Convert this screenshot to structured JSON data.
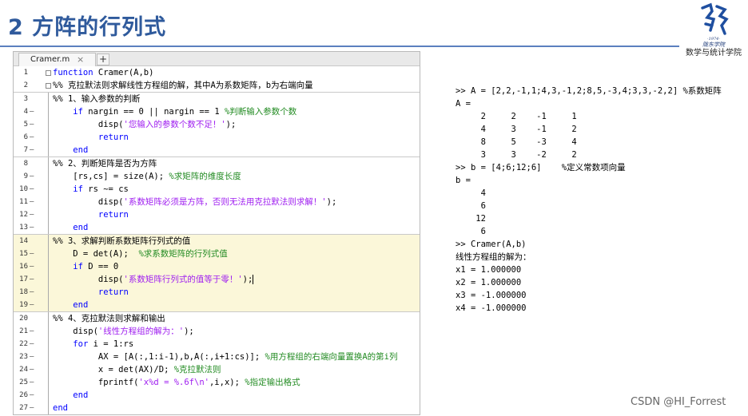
{
  "slide": {
    "title": "2 方阵的行列式",
    "logo": {
      "school": "陇东学院",
      "year": "·1974·",
      "dept": "数学与统计学院"
    },
    "watermark": "CSDN @HI_Forrest"
  },
  "editor": {
    "tab_name": "Cramer.m",
    "tab_close": "×",
    "add_tab": "+",
    "lines": [
      {
        "n": "1",
        "m": "",
        "t": "function Cramer(A,b)"
      },
      {
        "n": "2",
        "m": "",
        "t": "%% 克拉默法则求解线性方程组的解，其中A为系数矩阵，b为右端向量"
      },
      {
        "n": "3",
        "m": "",
        "t": "%% 1、输入参数的判断"
      },
      {
        "n": "4",
        "m": "—",
        "t": "if nargin == 0 || nargin == 1 %判断输入参数个数"
      },
      {
        "n": "5",
        "m": "—",
        "t": "disp('您输入的参数个数不足！');"
      },
      {
        "n": "6",
        "m": "—",
        "t": "return"
      },
      {
        "n": "7",
        "m": "—",
        "t": "end"
      },
      {
        "n": "8",
        "m": "",
        "t": "%% 2、判断矩阵是否为方阵"
      },
      {
        "n": "9",
        "m": "—",
        "t": "[rs,cs] = size(A); %求矩阵的维度长度"
      },
      {
        "n": "10",
        "m": "—",
        "t": "if rs ~= cs"
      },
      {
        "n": "11",
        "m": "—",
        "t": "disp('系数矩阵必须是方阵，否则无法用克拉默法则求解！');"
      },
      {
        "n": "12",
        "m": "—",
        "t": "return"
      },
      {
        "n": "13",
        "m": "—",
        "t": "end"
      },
      {
        "n": "14",
        "m": "",
        "t": "%% 3、求解判断系数矩阵行列式的值"
      },
      {
        "n": "15",
        "m": "—",
        "t": "D = det(A);  %求系数矩阵的行列式值"
      },
      {
        "n": "16",
        "m": "—",
        "t": "if D == 0"
      },
      {
        "n": "17",
        "m": "—",
        "t": "disp('系数矩阵行列式的值等于零！');"
      },
      {
        "n": "18",
        "m": "—",
        "t": "return"
      },
      {
        "n": "19",
        "m": "—",
        "t": "end"
      },
      {
        "n": "20",
        "m": "",
        "t": "%% 4、克拉默法则求解和输出"
      },
      {
        "n": "21",
        "m": "—",
        "t": "disp('线性方程组的解为：');"
      },
      {
        "n": "22",
        "m": "—",
        "t": "for i = 1:rs"
      },
      {
        "n": "23",
        "m": "—",
        "t": "AX = [A(:,1:i-1),b,A(:,i+1:cs)]; %用方程组的右端向量置换A的第i列"
      },
      {
        "n": "24",
        "m": "—",
        "t": "x = det(AX)/D; %克拉默法则"
      },
      {
        "n": "25",
        "m": "—",
        "t": "fprintf('x%d = %.6f\\n',i,x); %指定输出格式"
      },
      {
        "n": "26",
        "m": "—",
        "t": "end"
      },
      {
        "n": "27",
        "m": "—",
        "t": "end"
      }
    ]
  },
  "console": {
    "lines": [
      ">> A = [2,2,-1,1;4,3,-1,2;8,5,-3,4;3,3,-2,2] %系数矩阵",
      "A =",
      "     2     2    -1     1",
      "     4     3    -1     2",
      "     8     5    -3     4",
      "     3     3    -2     2",
      ">> b = [4;6;12;6]    %定义常数项向量",
      "b =",
      "     4",
      "     6",
      "    12",
      "     6",
      ">> Cramer(A,b)",
      "线性方程组的解为：",
      "x1 = 1.000000",
      "x2 = 1.000000",
      "x3 = -1.000000",
      "x4 = -1.000000"
    ]
  }
}
